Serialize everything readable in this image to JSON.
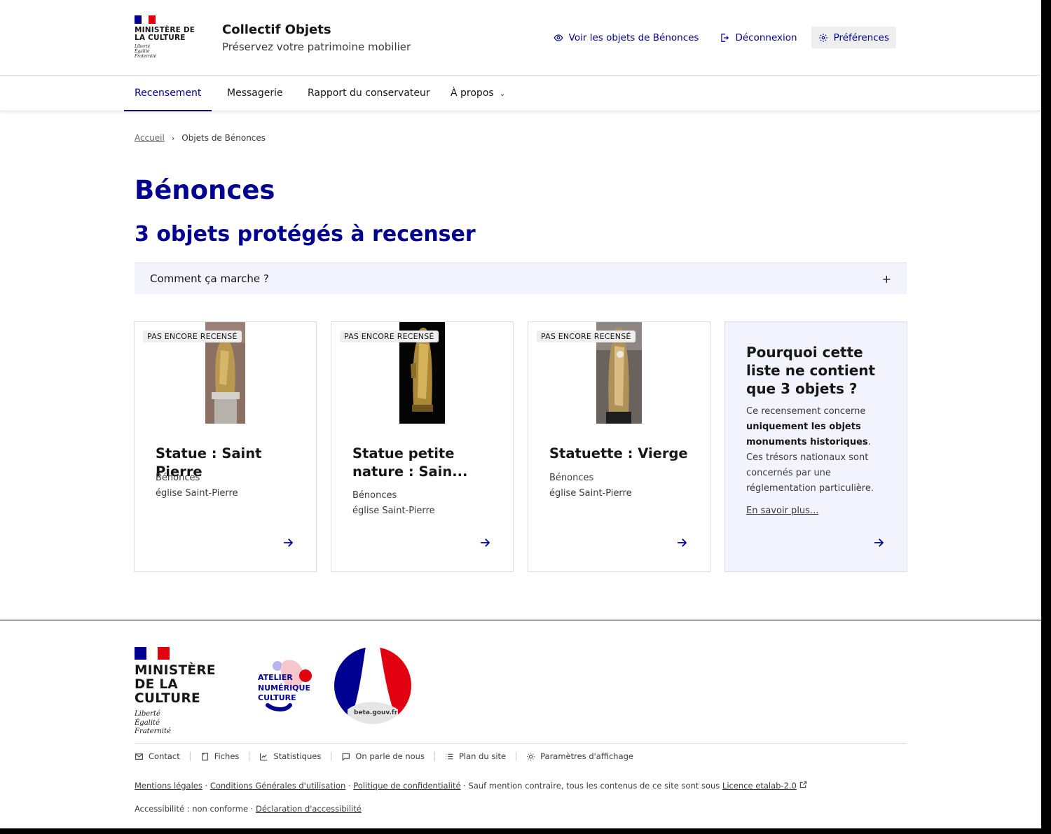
{
  "colors": {
    "primary": "#000091",
    "accent_red": "#e1000f",
    "card_info_bg": "#f3f3fd"
  },
  "header": {
    "ministry_name": "MINISTÈRE DE LA CULTURE",
    "motto": [
      "Liberté",
      "Égalité",
      "Fraternité"
    ],
    "site_title": "Collectif Objets",
    "tagline": "Préservez votre patrimoine mobilier",
    "links": {
      "view_objects": "Voir les objets de Bénonces",
      "logout": "Déconnexion",
      "preferences": "Préférences"
    }
  },
  "nav": {
    "items": [
      "Recensement",
      "Messagerie",
      "Rapport du conservateur",
      "À propos"
    ],
    "active": "Recensement"
  },
  "breadcrumb": {
    "home": "Accueil",
    "current": "Objets de Bénonces"
  },
  "page": {
    "title": "Bénonces",
    "subtitle": "3 objets protégés à recenser",
    "accordion_label": "Comment ça marche ?",
    "accordion_icon": "plus-icon"
  },
  "cards": [
    {
      "tag": "PAS ENCORE RECENSÉ",
      "title": "Statue : Saint Pierre",
      "commune": "Bénonces",
      "building": "église Saint-Pierre"
    },
    {
      "tag": "PAS ENCORE RECENSÉ",
      "title": "Statue petite nature : Sain...",
      "commune": "Bénonces",
      "building": "église Saint-Pierre"
    },
    {
      "tag": "PAS ENCORE RECENSÉ",
      "title": "Statuette : Vierge",
      "commune": "Bénonces",
      "building": "église Saint-Pierre"
    }
  ],
  "info_card": {
    "title": "Pourquoi cette liste ne contient que 3 objets ?",
    "text_before": "Ce recensement concerne ",
    "text_bold": "uniquement les objets monuments historiques",
    "text_after": ". Ces trésors nationaux sont concernés par une réglementation particulière.",
    "link": "En savoir plus..."
  },
  "footer": {
    "ministry_name": "MINISTÈRE DE LA CULTURE",
    "motto": [
      "Liberté",
      "Égalité",
      "Fraternité"
    ],
    "atelier": "ATELIER NUMÉRIQUE CULTURE",
    "beta": "beta.gouv.fr",
    "links": [
      "Contact",
      "Fiches",
      "Statistiques",
      "On parle de nous",
      "Plan du site",
      "Paramètres d'affichage"
    ],
    "legal": {
      "mentions": "Mentions légales",
      "cgu": "Conditions Générales d'utilisation",
      "privacy": "Politique de confidentialité",
      "license_text": "Sauf mention contraire, tous les contenus de ce site sont sous ",
      "license_link": "Licence etalab-2.0"
    },
    "accessibility_status": "Accessibilité : non conforme",
    "accessibility_link": "Déclaration d'accessibilité"
  }
}
